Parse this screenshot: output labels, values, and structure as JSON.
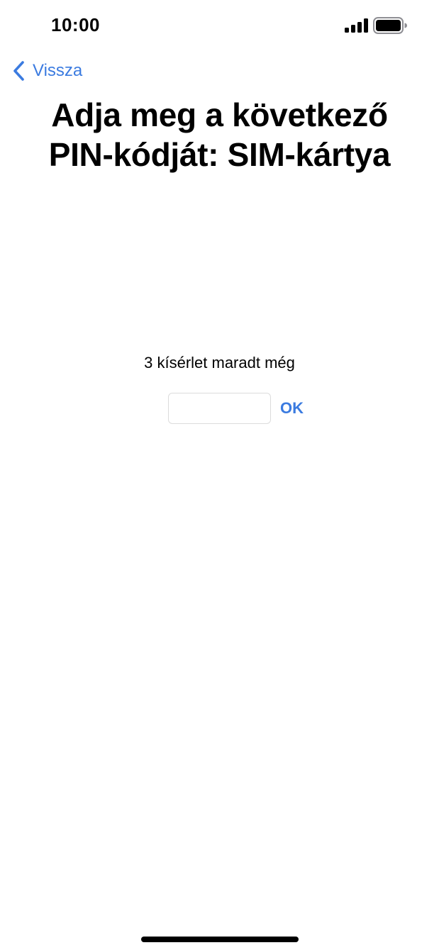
{
  "status_bar": {
    "time": "10:00",
    "signal_icon": "cellular-signal-icon",
    "battery_icon": "battery-full-icon"
  },
  "navigation": {
    "back_label": "Vissza",
    "back_icon": "chevron-left-icon"
  },
  "title": {
    "line1": "Adja meg a következő",
    "line2": "PIN-kódját: SIM-kártya"
  },
  "pin_entry": {
    "attempts_text": "3 kísérlet maradt még",
    "value": "",
    "ok_label": "OK"
  },
  "colors": {
    "accent": "#3b7be0",
    "text": "#000000",
    "background": "#ffffff"
  }
}
